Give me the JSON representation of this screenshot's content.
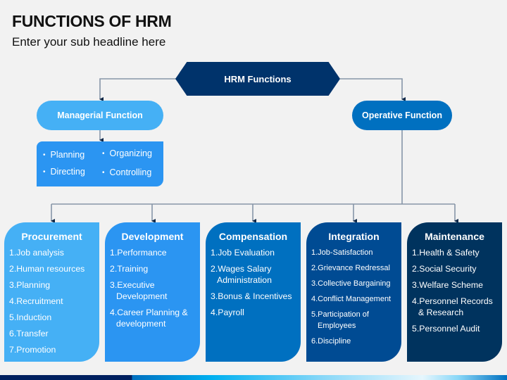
{
  "header": {
    "title": "FUNCTIONS OF HRM",
    "subtitle": "Enter your sub headline here"
  },
  "root": {
    "label": "HRM Functions",
    "color": "#00336b"
  },
  "branches": {
    "managerial": {
      "label": "Managerial Function",
      "color": "#45b0f5",
      "items": [
        "Planning",
        "Organizing",
        "Directing",
        "Controlling"
      ],
      "items_box_color": "#2b95f2"
    },
    "operative": {
      "label": "Operative Function",
      "color": "#0070c0"
    }
  },
  "cards": [
    {
      "title": "Procurement",
      "color": "#45b0f5",
      "items": [
        [
          "1.Job analysis"
        ],
        [
          "2.Human resources"
        ],
        [
          "3.Planning"
        ],
        [
          "4.Recruitment"
        ],
        [
          "5.Induction"
        ],
        [
          "6.Transfer"
        ],
        [
          "7.Promotion"
        ]
      ]
    },
    {
      "title": "Development",
      "color": "#2b95f2",
      "items": [
        [
          "1.Performance"
        ],
        [
          "2.Training"
        ],
        [
          "3.Executive",
          "Development"
        ],
        [
          "4.Career Planning &",
          "development"
        ]
      ]
    },
    {
      "title": "Compensation",
      "color": "#0070c0",
      "items": [
        [
          "1.Job Evaluation"
        ],
        [
          "2.Wages Salary",
          "Administration"
        ],
        [
          "3.Bonus & Incentives"
        ],
        [
          "4.Payroll"
        ]
      ]
    },
    {
      "title": "Integration",
      "color": "#004b93",
      "items": [
        [
          "1.Job-Satisfaction"
        ],
        [
          "2.Grievance Redressal"
        ],
        [
          "3.Collective Bargaining"
        ],
        [
          "4.Conflict Management"
        ],
        [
          "5.Participation of",
          "Employees"
        ],
        [
          "6.Discipline"
        ]
      ]
    },
    {
      "title": "Maintenance",
      "color": "#00335e",
      "items": [
        [
          "1.Health & Safety"
        ],
        [
          "2.Social Security"
        ],
        [
          "3.Welfare Scheme"
        ],
        [
          "4.Personnel Records",
          "& Research"
        ],
        [
          "5.Personnel Audit"
        ]
      ]
    }
  ],
  "colors": {
    "connector": "#8796a8",
    "arrow": "#0d2748",
    "background": "#f2f2f2"
  }
}
